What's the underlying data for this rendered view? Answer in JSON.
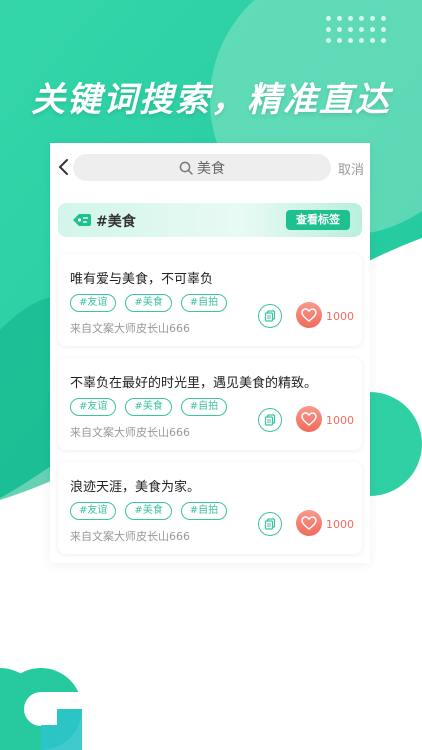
{
  "headline": "关键词搜索，精准直达",
  "search": {
    "query": "美食",
    "cancel_label": "取消"
  },
  "tag_banner": {
    "tag": "#美食",
    "button_label": "查看标签"
  },
  "cards": [
    {
      "text": "唯有爱与美食，不可辜负",
      "tags": [
        "#友谊",
        "#美食",
        "#自拍"
      ],
      "source": "来自文案大师皮长山666",
      "likes": "1000"
    },
    {
      "text": "不辜负在最好的时光里，遇见美食的精致。",
      "tags": [
        "#友谊",
        "#美食",
        "#自拍"
      ],
      "source": "来自文案大师皮长山666",
      "likes": "1000"
    },
    {
      "text": "浪迹天涯，美食为家。",
      "tags": [
        "#友谊",
        "#美食",
        "#自拍"
      ],
      "source": "来自文案大师皮长山666",
      "likes": "1000"
    }
  ],
  "colors": {
    "brand_green": "#1fc08f",
    "like_red": "#f06a5c"
  }
}
